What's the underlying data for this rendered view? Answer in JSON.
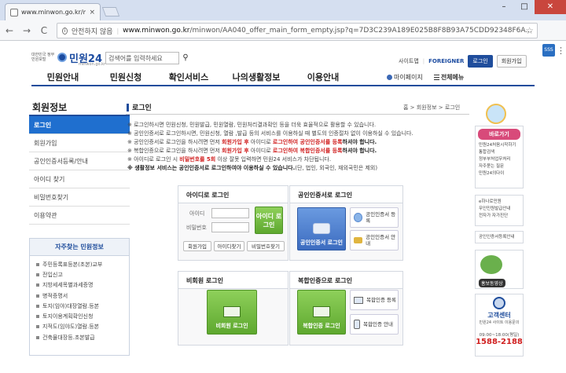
{
  "browser": {
    "tab_title": "www.minwon.go.kr/min",
    "tab_close": "×",
    "security": "안전하지 않음",
    "url_host": "www.minwon.go.kr",
    "url_path": "/minwon/AA040_offer_main_form_empty.jsp?q=7D3C239A189E025B8F8B93A75CDD92348F6A...",
    "ext_label": "SSS",
    "back": "←",
    "forward": "→",
    "reload": "C"
  },
  "header": {
    "logo_small": "대한민국 정부민원포털",
    "logo_big": "민원24",
    "logo_sub": "minwon.go.kr",
    "search_placeholder": "검색어를 입력하세요",
    "search_icon": "search-icon",
    "links": {
      "sitemap": "사이트맵",
      "foreigner": "FOREIGNER",
      "login": "로그인",
      "join": "회원가입"
    }
  },
  "gnb": {
    "items": [
      "민원안내",
      "민원신청",
      "확인서비스",
      "나의생활정보",
      "이용안내"
    ],
    "mypage": "마이페이지",
    "allmenu": "전체메뉴"
  },
  "lnb": {
    "title": "회원정보",
    "items": [
      "로그인",
      "회원가입",
      "공인인증서등록/안내",
      "아이디 찾기",
      "비밀번호찾기",
      "이용약관"
    ]
  },
  "faq": {
    "title": "자주찾는 민원정보",
    "items": [
      "주민등록표등본(초본)교부",
      "전입신고",
      "지방세세목별과세증명",
      "병적증명서",
      "토지(임야)대장열람.등본",
      "토지이용계획확인신청",
      "지적도(임야도)열람.등본",
      "건축물대장등.초본발급"
    ]
  },
  "main": {
    "title": "로그인",
    "breadcrumb": "홈 > 회원정보 > 로그인",
    "notices": [
      {
        "pre": "※ 로그인하시면 민원신청, 민원발급, 민원열람, 민원처리결과확인 등을 더욱 효율적으로 활용할 수 있습니다.",
        "red": "",
        "mid": "",
        "red2": "",
        "post": ""
      },
      {
        "pre": "※ 공인인증서로 로그인하시면, 민원신청, 열람 ,발급 등의 서비스를 이용하실 때 별도의 인증절차 없이 이용하실 수 있습니다.",
        "red": "",
        "mid": "",
        "red2": "",
        "post": ""
      },
      {
        "pre": "※ 공인인증서로 로그인을 하시려면 먼저 ",
        "red": "회원가입 후",
        "mid": " 아이디로 ",
        "red2": "로그인하여 공인인증서를 등록",
        "post": "하셔야 합니다."
      },
      {
        "pre": "※ 복합인증으로 로그인을 하시려면 먼저 ",
        "red": "회원가입 후",
        "mid": " 아이디로 ",
        "red2": "로그인하여 복합인증서를 등록",
        "post": "하셔야 합니다."
      },
      {
        "pre": "※ 아이디로 로그인 시 ",
        "red": "비밀번호를 5회",
        "mid": " 이상 잘못 입력하면 민원24 서비스가 차단됩니다.",
        "red2": "",
        "post": ""
      },
      {
        "pre": "※ 생활정보 서비스는 공인인증서로 로그인하여야 이용하실 수 있습니다.",
        "red": "",
        "mid": "(단, 법인, 외국인, 재외국민은 제외)",
        "red2": "",
        "post": ""
      }
    ],
    "id_login": {
      "title": "아이디로 로그인",
      "id_label": "아이디",
      "pw_label": "비밀번호",
      "submit": "아이디 로그인",
      "join": "회원가입",
      "find_id": "아이디찾기",
      "find_pw": "비밀번호찾기"
    },
    "cert_login": {
      "title": "공인인증서로 로그인",
      "submit": "공인인증서 로그인",
      "register": "공인인증서 등록",
      "guide": "공인인증서 안내"
    },
    "nonmember": {
      "title": "비회원 로그인",
      "submit": "비회원 로그인"
    },
    "composite": {
      "title": "복합인증으로 로그인",
      "submit": "복합인증 로그인",
      "register": "복합인증 등록",
      "guide": "복합인증 안내"
    }
  },
  "right": {
    "guide_title": "바로가기",
    "guide_items": [
      "민원24처음시작하기",
      "통합검색",
      "정부부처업무처리",
      "자주묻는 질문",
      "민원24의다이"
    ],
    "links2": [
      "e하나로민원",
      "무인민원발급안내",
      "전자가 자가진단"
    ],
    "link3": "공인인증서등록안내",
    "video": "홍보동영상",
    "callcenter_title": "고객센터",
    "callcenter_sub": "민원24 사이트 이용문의",
    "callcenter_hours": "09:00~18:00(평일)",
    "callcenter_phone": "1588-2188"
  },
  "colors": {
    "primary": "#1f4d9c",
    "active": "#1f6fcf",
    "alert": "#d02020",
    "green": "#5ea82f"
  }
}
